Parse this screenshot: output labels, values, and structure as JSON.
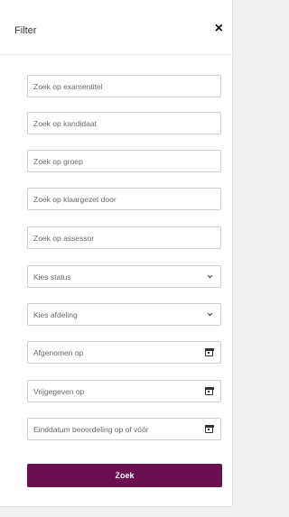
{
  "header": {
    "title": "Filter",
    "close_glyph": "×"
  },
  "inputs": {
    "exam_title": {
      "placeholder": "Zoek op examentitel"
    },
    "candidate": {
      "placeholder": "Zoek op kandidaat"
    },
    "group": {
      "placeholder": "Zoek op groep"
    },
    "prepared_by": {
      "placeholder": "Zoek op klaargezet door"
    },
    "assessor": {
      "placeholder": "Zoek op assessor"
    }
  },
  "selects": {
    "status": {
      "value": "Kies status"
    },
    "department": {
      "value": "Kies afdeling"
    }
  },
  "dates": {
    "taken_on": {
      "placeholder": "Afgenomen op"
    },
    "released_on": {
      "placeholder": "Vrijgegeven op"
    },
    "assessment_deadline": {
      "placeholder": "Einddatum beoordeling op of vóór"
    }
  },
  "search_button": {
    "label": "Zoek"
  },
  "colors": {
    "accent": "#6b0f4f",
    "border": "#cfcfcf",
    "placeholder_text": "#6b6b6b"
  },
  "icons": {
    "close": "close-icon",
    "select": "chevron-down-icon",
    "date": "calendar-icon"
  }
}
